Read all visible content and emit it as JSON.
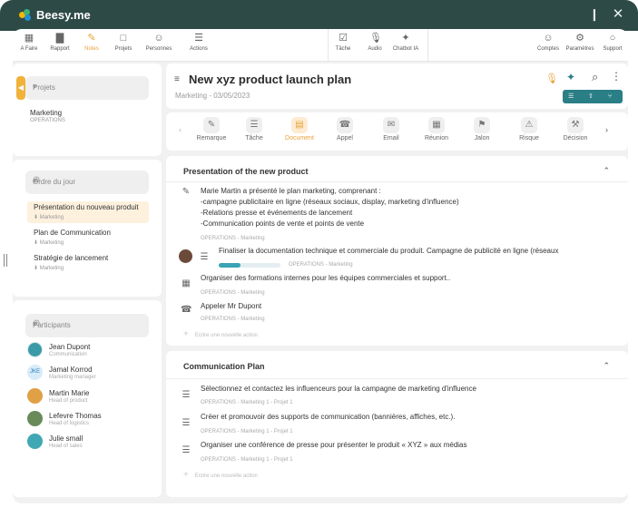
{
  "app": {
    "title": "Beesy.me",
    "colors": {
      "header": "#2d4a47",
      "accent": "#e8a23a",
      "teal": "#2a7f87",
      "progress": "#3ba3b5"
    }
  },
  "toolbar": {
    "left": [
      {
        "label": "A Faire",
        "icon": "grid-icon"
      },
      {
        "label": "Rapport",
        "icon": "bar-chart-icon"
      },
      {
        "label": "Notes",
        "icon": "pencil-icon",
        "active": true
      },
      {
        "label": "Projets",
        "icon": "folder-icon"
      },
      {
        "label": "Personnes",
        "icon": "person-icon"
      },
      {
        "label": "Actions",
        "icon": "checklist-icon"
      }
    ],
    "middle": [
      {
        "label": "Tâche",
        "icon": "task-icon"
      },
      {
        "label": "Audio",
        "icon": "microphone-icon"
      },
      {
        "label": "Chatbot IA",
        "icon": "sparkle-icon"
      }
    ],
    "right": [
      {
        "label": "Comptes",
        "icon": "person-icon"
      },
      {
        "label": "Paramètres",
        "icon": "gear-icon"
      },
      {
        "label": "Support",
        "icon": "chat-icon"
      }
    ]
  },
  "sidebar": {
    "projects": {
      "placeholder": "Projets",
      "item": {
        "name": "Marketing",
        "sub": "OPERATIONS"
      }
    },
    "agenda": {
      "placeholder": "Ordre du jour",
      "items": [
        {
          "label": "Présentation du nouveau produit",
          "sub": "Marketing",
          "active": true
        },
        {
          "label": "Plan de Communication",
          "sub": "Marketing"
        },
        {
          "label": "Stratégie de lancement",
          "sub": "Marketing"
        }
      ]
    },
    "participants": {
      "placeholder": "Participants",
      "items": [
        {
          "name": "Jean Dupont",
          "role": "Communication"
        },
        {
          "name": "Jamal Korrod",
          "role": "Marketing manager",
          "initials": "JKE"
        },
        {
          "name": "Martin Marie",
          "role": "Head of product"
        },
        {
          "name": "Lefevre Thomas",
          "role": "Head of logistics"
        },
        {
          "name": "Julie small",
          "role": "Head of sales"
        }
      ]
    }
  },
  "doc": {
    "title": "New xyz product launch plan",
    "subtitle": "Marketing - 03/05/2023"
  },
  "actions": [
    "Remarque",
    "Tâche",
    "Document",
    "Appel",
    "Email",
    "Réunion",
    "Jalon",
    "Risque",
    "Décision"
  ],
  "sections": [
    {
      "title": "Presentation of the new product",
      "rows": [
        {
          "icon": "pencil-icon",
          "lines": [
            "Marie Martin a présenté le plan marketing, comprenant :",
            "-campagne publicitaire en ligne (réseaux sociaux, display, marketing d'influence)",
            "-Relations presse et événements de lancement",
            "-Communication points de vente et points de vente"
          ],
          "meta": "OPERATIONS - Marketing"
        },
        {
          "icon": "checklist-icon",
          "lines": [
            "Finaliser la documentation technique et commerciale du produit. Campagne de publicité en ligne (réseaux"
          ],
          "meta": "OPERATIONS - Marketing",
          "progress": 0.35
        },
        {
          "icon": "calendar-icon",
          "lines": [
            "Organiser des formations internes pour les équipes commerciales et support.."
          ],
          "meta": "OPERATIONS - Marketing"
        },
        {
          "icon": "phone-icon",
          "lines": [
            "Appeler Mr Dupont"
          ],
          "meta": "OPERATIONS - Marketing"
        }
      ],
      "add": "Ecrire une nouvelle action"
    },
    {
      "title": "Communication Plan",
      "rows": [
        {
          "icon": "checklist-icon",
          "lines": [
            "Sélectionnez et contactez les influenceurs pour la campagne de marketing d'influence"
          ],
          "meta": "OPERATIONS - Marketing   1 - Projet 1"
        },
        {
          "icon": "checklist-icon",
          "lines": [
            "Créer et promouvoir des supports de communication (bannières, affiches, etc.)."
          ],
          "meta": "OPERATIONS - Marketing   1 - Projet 1"
        },
        {
          "icon": "checklist-icon",
          "lines": [
            "Organiser une conférence de presse pour présenter le produit « XYZ » aux médias"
          ],
          "meta": "OPERATIONS - Marketing   1 - Projet 1"
        }
      ],
      "add": "Ecrire une nouvelle action"
    }
  ]
}
